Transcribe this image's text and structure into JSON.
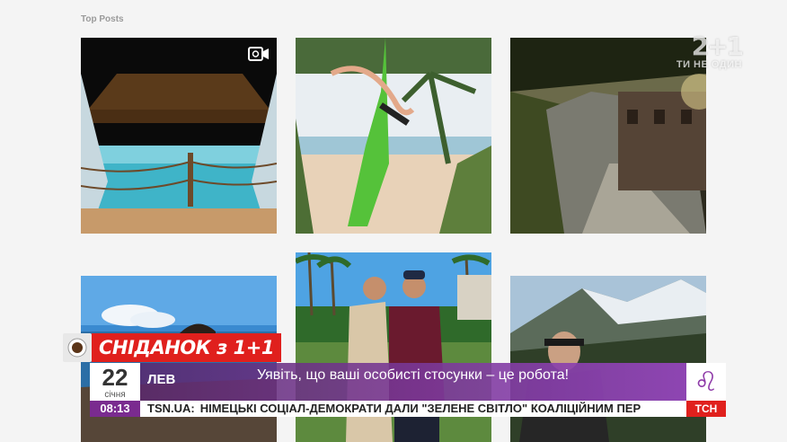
{
  "section": {
    "title": "Top Posts"
  },
  "watermark": {
    "logo": "2+1",
    "tagline": "ТИ НЕ ОДИН"
  },
  "tiles": [
    {
      "name": "post-beach-hut",
      "has_video": true
    },
    {
      "name": "post-aerial-silk"
    },
    {
      "name": "post-cobblestone-street"
    },
    {
      "name": "post-sea-rocks"
    },
    {
      "name": "post-two-men-palms"
    },
    {
      "name": "post-mountain-selfie"
    }
  ],
  "overlay": {
    "show_name": "СНІДАНОК з 1+1",
    "date_day": "22",
    "date_month": "січня",
    "time": "08:13",
    "zodiac": "ЛЕВ",
    "zodiac_symbol": "♌",
    "headline": "Уявіть, що ваші особисті стосунки – це робота!",
    "ticker_site": "TSN.UA:",
    "ticker_text": "НІМЕЦЬКІ СОЦІАЛ-ДЕМОКРАТИ ДАЛИ \"ЗЕЛЕНЕ СВІТЛО\" КОАЛІЦІЙНИМ ПЕР",
    "channel": "ТСН"
  }
}
